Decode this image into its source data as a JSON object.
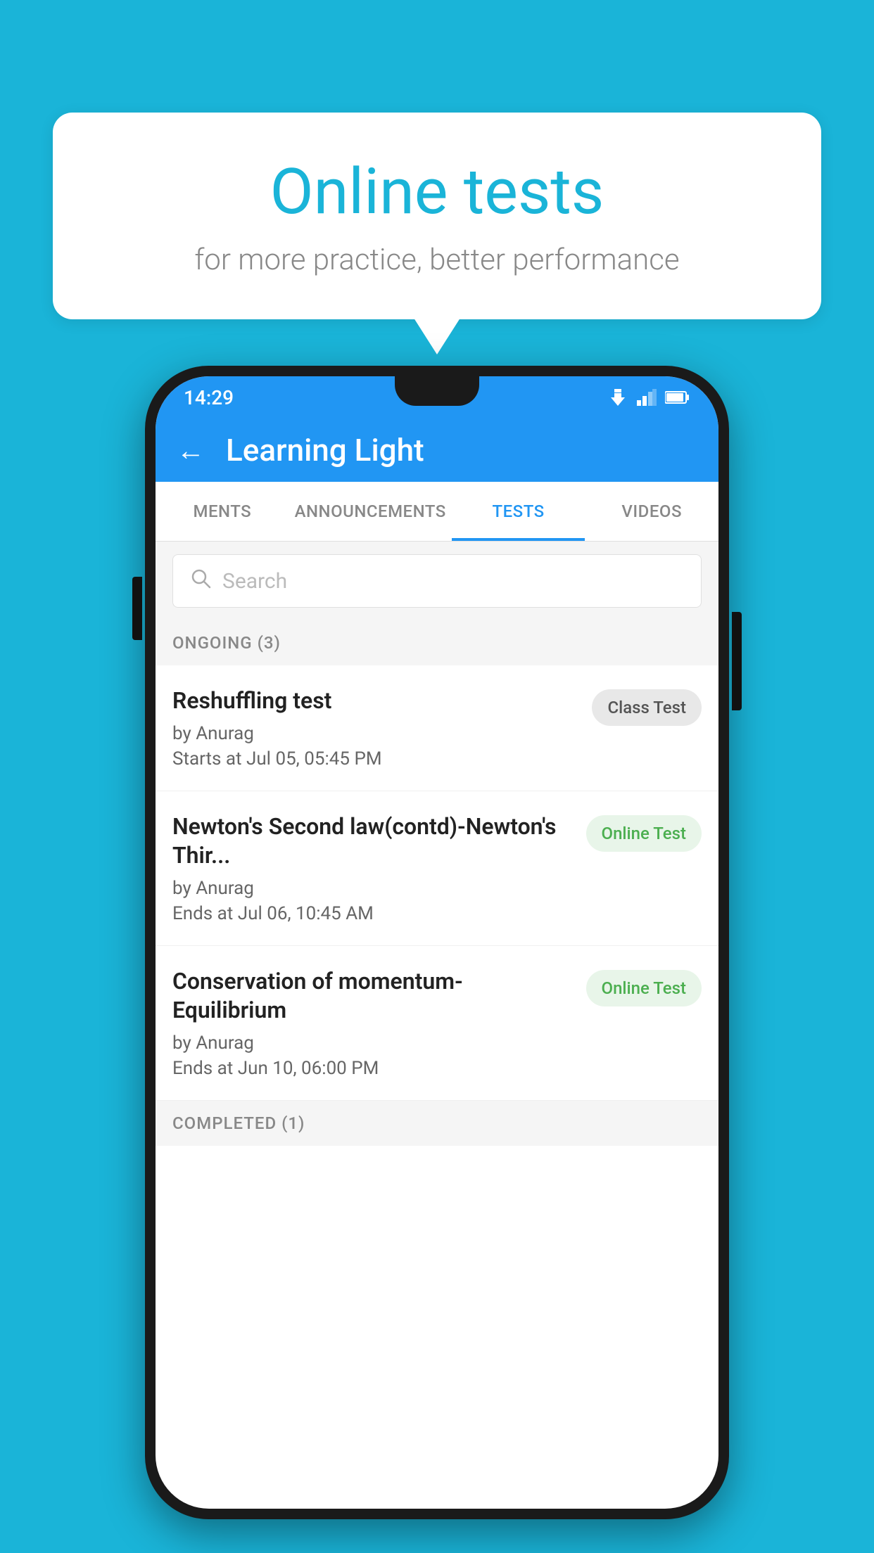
{
  "background": {
    "color": "#1ab4d8"
  },
  "speech_bubble": {
    "title": "Online tests",
    "subtitle": "for more practice, better performance"
  },
  "phone": {
    "status_bar": {
      "time": "14:29",
      "wifi": "▼",
      "signal": "▲",
      "battery": "▐"
    },
    "app_bar": {
      "back_label": "←",
      "title": "Learning Light"
    },
    "tabs": [
      {
        "label": "MENTS",
        "active": false
      },
      {
        "label": "ANNOUNCEMENTS",
        "active": false
      },
      {
        "label": "TESTS",
        "active": true
      },
      {
        "label": "VIDEOS",
        "active": false
      }
    ],
    "search": {
      "placeholder": "Search"
    },
    "ongoing_section": {
      "label": "ONGOING (3)"
    },
    "tests": [
      {
        "title": "Reshuffling test",
        "author": "by Anurag",
        "date": "Starts at  Jul 05, 05:45 PM",
        "badge": "Class Test",
        "badge_type": "class"
      },
      {
        "title": "Newton's Second law(contd)-Newton's Thir...",
        "author": "by Anurag",
        "date": "Ends at  Jul 06, 10:45 AM",
        "badge": "Online Test",
        "badge_type": "online"
      },
      {
        "title": "Conservation of momentum-Equilibrium",
        "author": "by Anurag",
        "date": "Ends at  Jun 10, 06:00 PM",
        "badge": "Online Test",
        "badge_type": "online"
      }
    ],
    "completed_section": {
      "label": "COMPLETED (1)"
    }
  }
}
